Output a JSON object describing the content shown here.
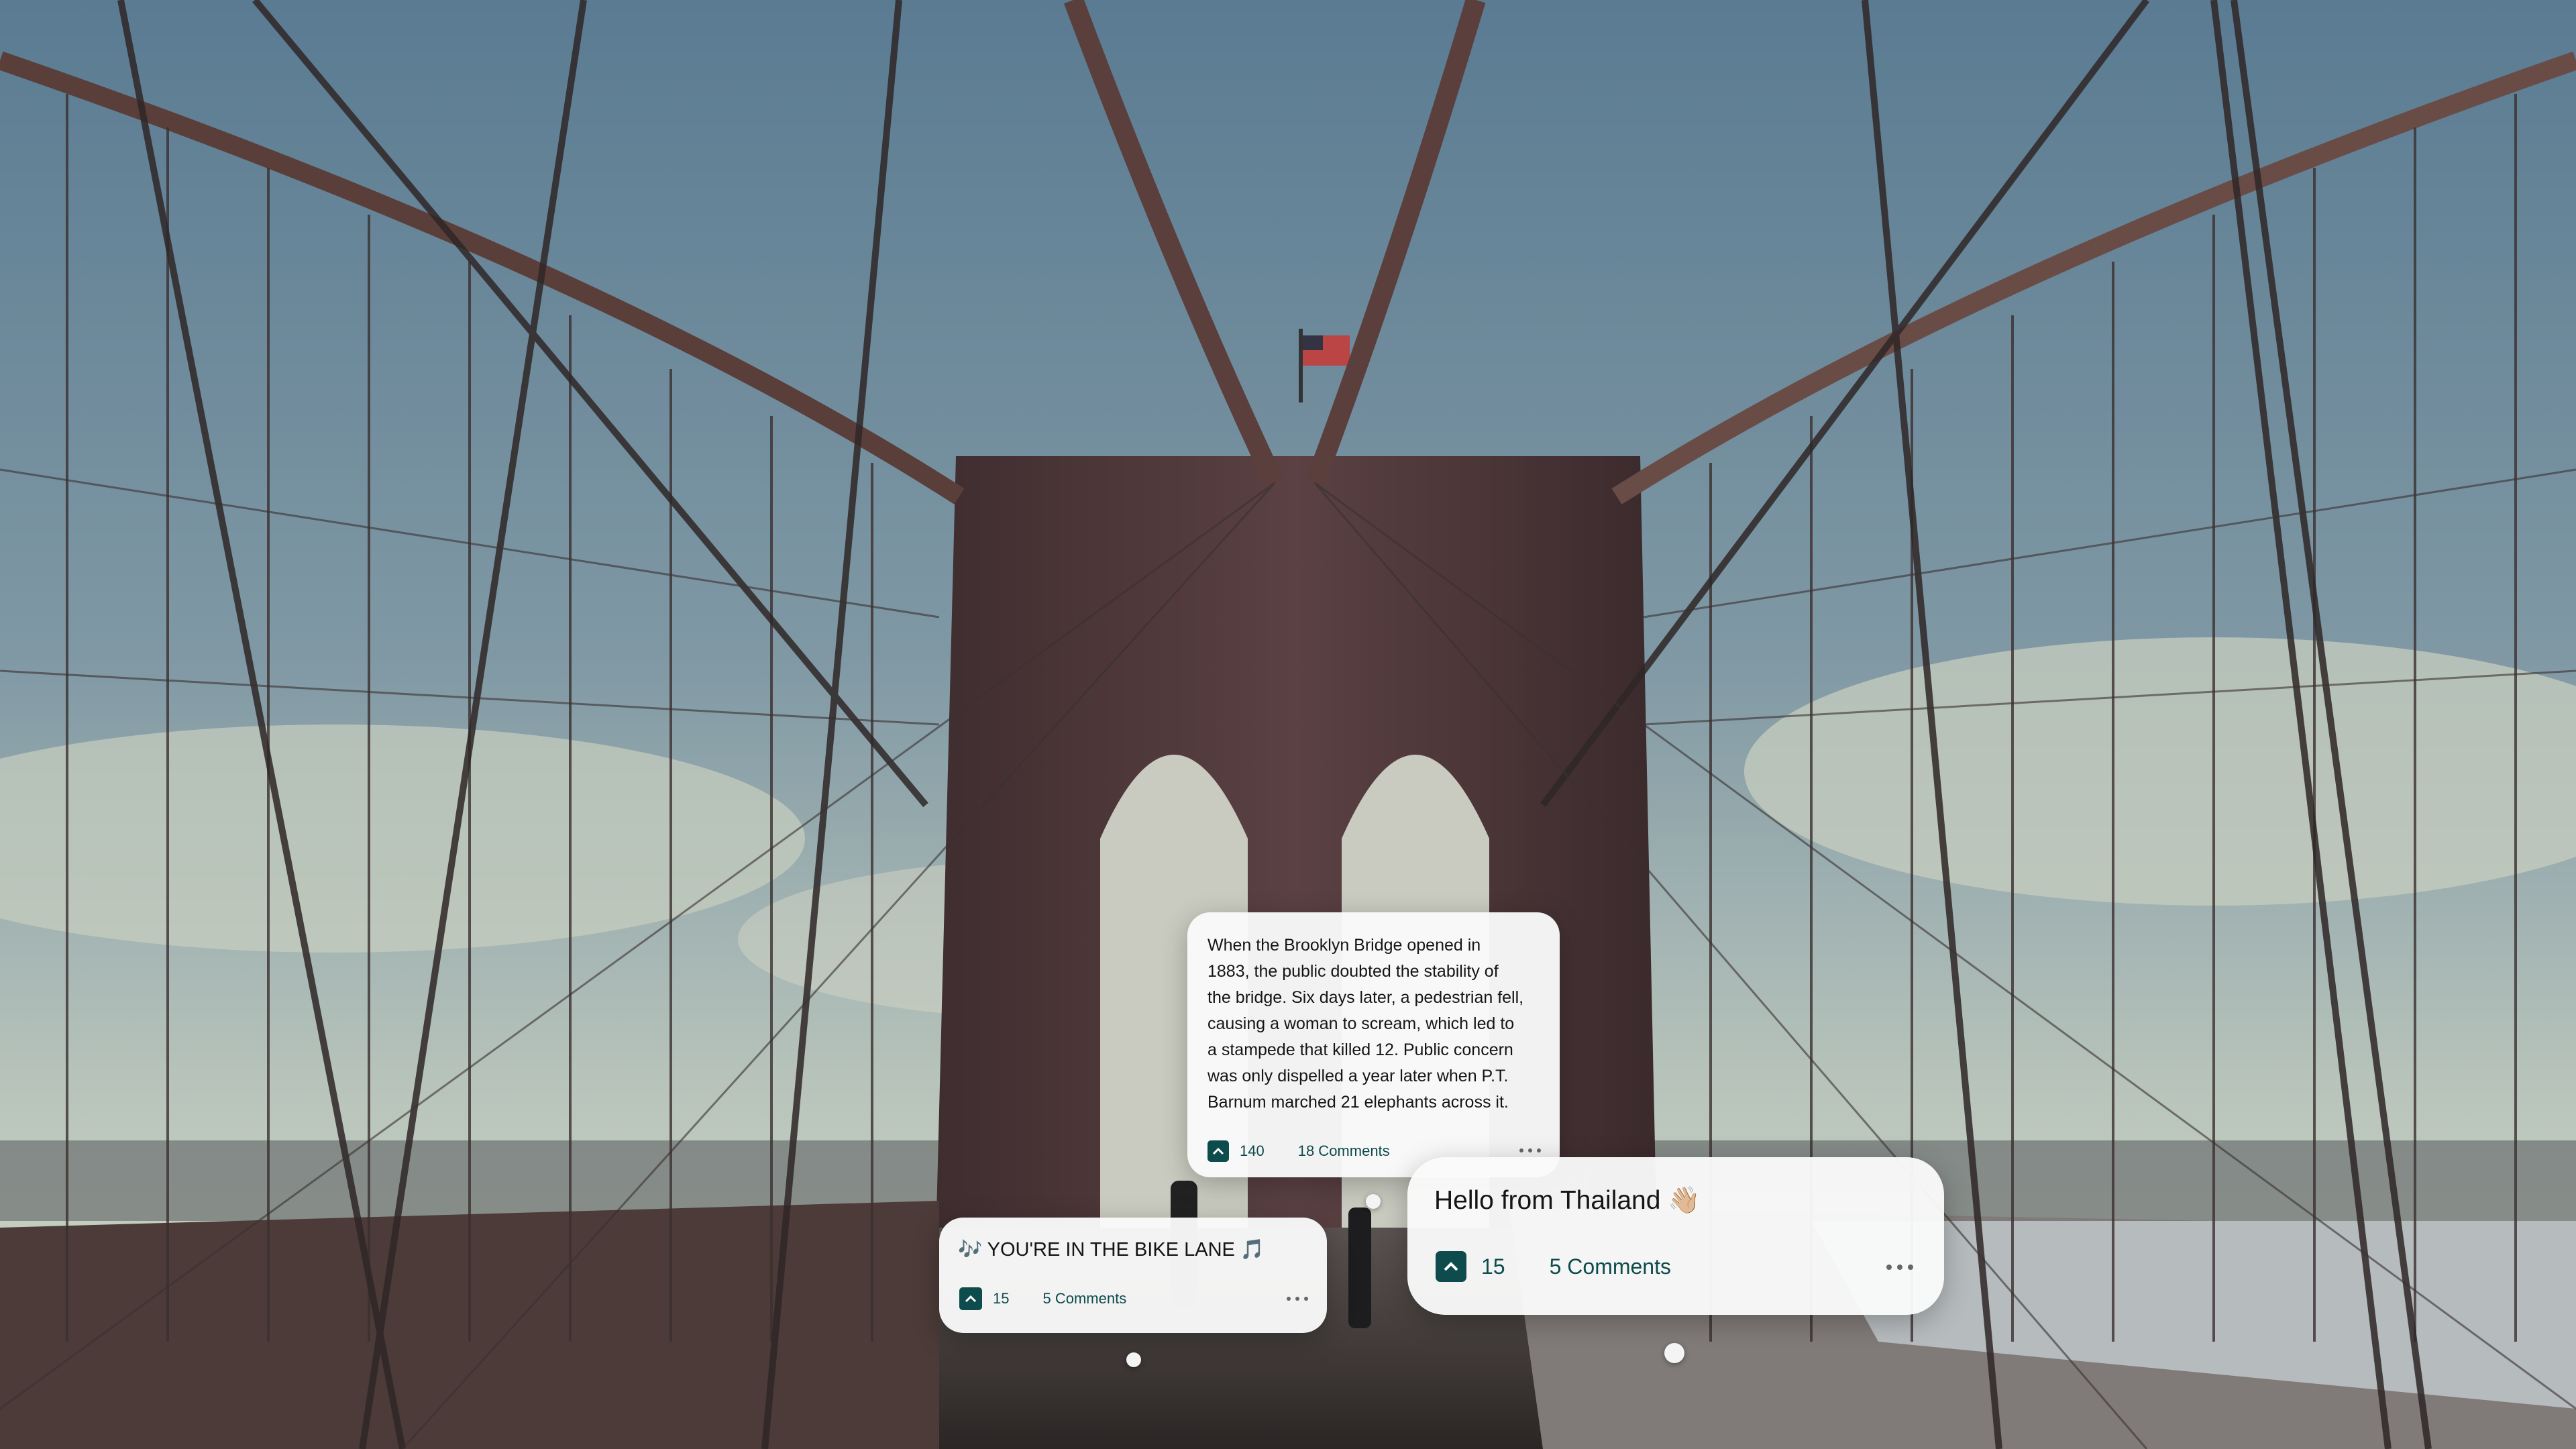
{
  "scene": {
    "description_icon": "brooklyn-bridge-photo",
    "colors": {
      "sky_top": "#5f7f95",
      "sky_bottom": "#b9c6c2",
      "tower": "#4d3535",
      "cable": "#3a2f2f",
      "walkway": "#3b3634"
    }
  },
  "cards": [
    {
      "id": "fact-card",
      "text": "When the Brooklyn Bridge opened in\n1883, the public doubted the stability of\nthe bridge. Six days later, a pedestrian fell,\ncausing a woman to scream, which led to\na stampede that killed 12. Public concern\nwas only dispelled a year later when P.T.\nBarnum marched 21 elephants across it.",
      "votes": "140",
      "comments": "18 Comments"
    },
    {
      "id": "bike-lane-card",
      "text": "🎶 YOU'RE IN THE BIKE LANE 🎵",
      "votes": "15",
      "comments": "5 Comments"
    },
    {
      "id": "thailand-card",
      "text": "Hello from Thailand 👋🏼",
      "votes": "15",
      "comments": "5 Comments"
    }
  ],
  "icons": {
    "upvote": "chevron-up-icon",
    "more": "more-dots-icon",
    "anchor": "location-dot-icon"
  },
  "colors": {
    "accent": "#0d4b4d",
    "card_bg": "#fafafa"
  }
}
